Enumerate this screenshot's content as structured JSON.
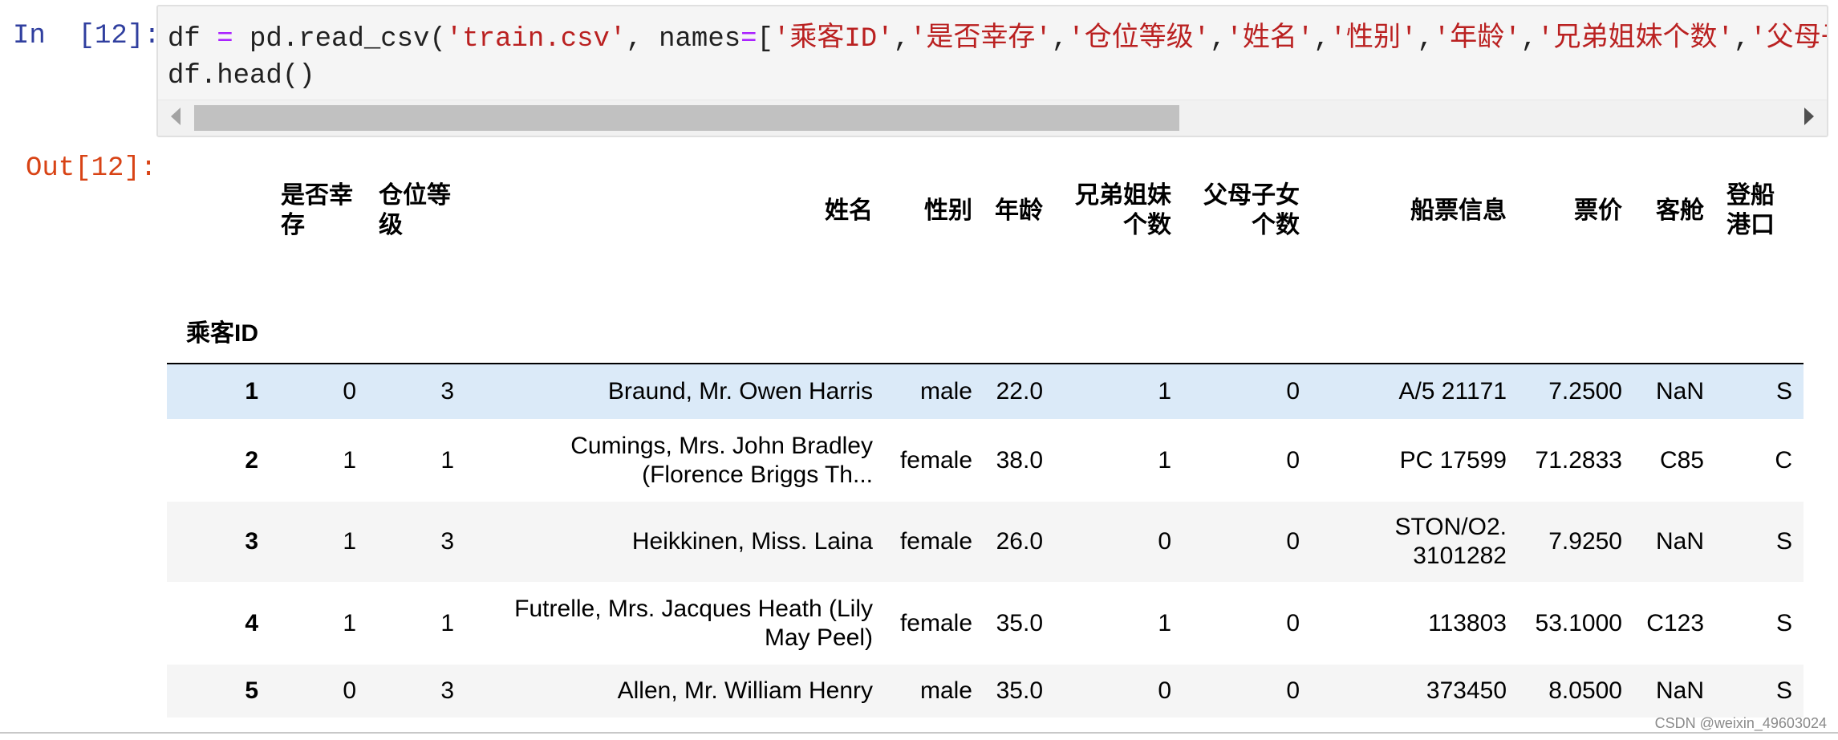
{
  "cell": {
    "in_prompt": "In  [12]:",
    "out_prompt": "Out[12]:",
    "code_line1": {
      "p1": "df ",
      "op1": "=",
      "p2": " pd.read_csv(",
      "s1": "'train.csv'",
      "p3": ", names",
      "op2": "=",
      "p4": "[",
      "s2": "'乘客ID'",
      "c1": ",",
      "s3": "'是否幸存'",
      "c2": ",",
      "s4": "'仓位等级'",
      "c3": ",",
      "s5": "'姓名'",
      "c4": ",",
      "s6": "'性别'",
      "c5": ",",
      "s7": "'年龄'",
      "c6": ",",
      "s8": "'兄弟姐妹个数'",
      "c7": ",",
      "s9": "'父母子女个"
    },
    "code_line2": "df.head()"
  },
  "table": {
    "index_name": "乘客ID",
    "columns": [
      "是否幸存",
      "仓位等级",
      "姓名",
      "性别",
      "年龄",
      "兄弟姐妹个数",
      "父母子女个数",
      "船票信息",
      "票价",
      "客舱",
      "登船港口"
    ],
    "rows": [
      {
        "index": "1",
        "cells": [
          "0",
          "3",
          "Braund, Mr. Owen Harris",
          "male",
          "22.0",
          "1",
          "0",
          "A/5 21171",
          "7.2500",
          "NaN",
          "S"
        ]
      },
      {
        "index": "2",
        "cells": [
          "1",
          "1",
          "Cumings, Mrs. John Bradley (Florence Briggs Th...",
          "female",
          "38.0",
          "1",
          "0",
          "PC 17599",
          "71.2833",
          "C85",
          "C"
        ]
      },
      {
        "index": "3",
        "cells": [
          "1",
          "3",
          "Heikkinen, Miss. Laina",
          "female",
          "26.0",
          "0",
          "0",
          "STON/O2. 3101282",
          "7.9250",
          "NaN",
          "S"
        ]
      },
      {
        "index": "4",
        "cells": [
          "1",
          "1",
          "Futrelle, Mrs. Jacques Heath (Lily May Peel)",
          "female",
          "35.0",
          "1",
          "0",
          "113803",
          "53.1000",
          "C123",
          "S"
        ]
      },
      {
        "index": "5",
        "cells": [
          "0",
          "3",
          "Allen, Mr. William Henry",
          "male",
          "35.0",
          "0",
          "0",
          "373450",
          "8.0500",
          "NaN",
          "S"
        ]
      }
    ]
  },
  "watermark": "CSDN @weixin_49603024",
  "colors": {
    "in_prompt": "#303f9f",
    "out_prompt": "#d84315",
    "operator": "#aa22ff",
    "string": "#ba2121",
    "row_hover": "#dbeaf8",
    "row_stripe": "#f5f5f5"
  },
  "icons": {
    "scroll_left": "triangle-left",
    "scroll_right": "triangle-right"
  }
}
